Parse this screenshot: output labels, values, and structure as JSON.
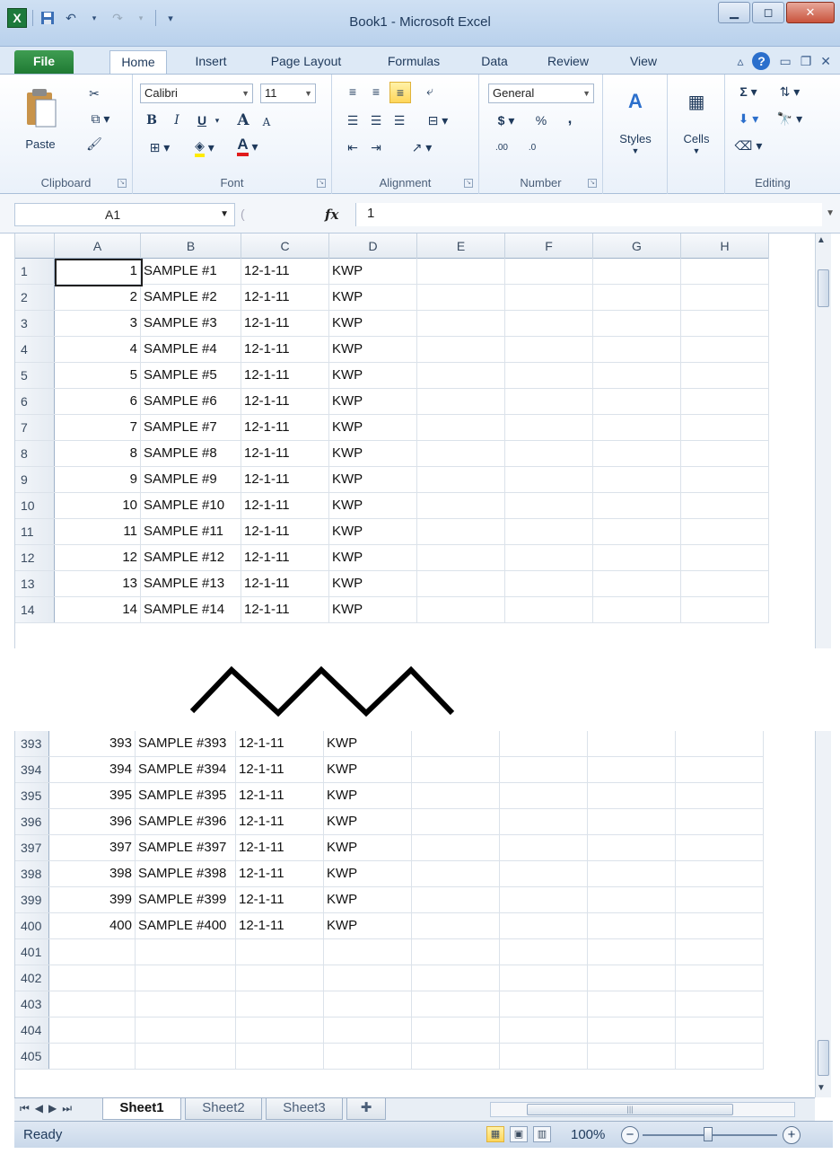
{
  "window": {
    "title": "Book1 - Microsoft Excel",
    "app_icon": "X",
    "controls": [
      "minimize-icon",
      "restore-icon",
      "close-icon"
    ]
  },
  "tabs": [
    "File",
    "Home",
    "Insert",
    "Page Layout",
    "Formulas",
    "Data",
    "Review",
    "View"
  ],
  "ribbon": {
    "clipboard": {
      "label": "Clipboard",
      "paste": "Paste"
    },
    "font": {
      "label": "Font",
      "name": "Calibri",
      "size": "11",
      "bold": "B",
      "italic": "I",
      "underline": "U",
      "grow": "A",
      "shrink": "A",
      "color": "A"
    },
    "alignment": {
      "label": "Alignment"
    },
    "number": {
      "label": "Number",
      "format": "General",
      "currency": "$",
      "percent": "%",
      "comma": ",",
      "inc_decimal": ".00",
      "dec_decimal": ".0"
    },
    "styles": {
      "label": "Styles"
    },
    "cells": {
      "label": "Cells"
    },
    "editing": {
      "label": "Editing",
      "sum": "Σ"
    }
  },
  "formula_bar": {
    "name_box": "A1",
    "fx": "fx",
    "value": "1"
  },
  "columns": [
    "A",
    "B",
    "C",
    "D",
    "E",
    "F",
    "G",
    "H"
  ],
  "rows_top": [
    {
      "n": "1",
      "a": "1",
      "b": "SAMPLE #1",
      "c": "12-1-11",
      "d": "KWP"
    },
    {
      "n": "2",
      "a": "2",
      "b": "SAMPLE #2",
      "c": "12-1-11",
      "d": "KWP"
    },
    {
      "n": "3",
      "a": "3",
      "b": "SAMPLE #3",
      "c": "12-1-11",
      "d": "KWP"
    },
    {
      "n": "4",
      "a": "4",
      "b": "SAMPLE #4",
      "c": "12-1-11",
      "d": "KWP"
    },
    {
      "n": "5",
      "a": "5",
      "b": "SAMPLE #5",
      "c": "12-1-11",
      "d": "KWP"
    },
    {
      "n": "6",
      "a": "6",
      "b": "SAMPLE #6",
      "c": "12-1-11",
      "d": "KWP"
    },
    {
      "n": "7",
      "a": "7",
      "b": "SAMPLE #7",
      "c": "12-1-11",
      "d": "KWP"
    },
    {
      "n": "8",
      "a": "8",
      "b": "SAMPLE #8",
      "c": "12-1-11",
      "d": "KWP"
    },
    {
      "n": "9",
      "a": "9",
      "b": "SAMPLE #9",
      "c": "12-1-11",
      "d": "KWP"
    },
    {
      "n": "10",
      "a": "10",
      "b": "SAMPLE #10",
      "c": "12-1-11",
      "d": "KWP"
    },
    {
      "n": "11",
      "a": "11",
      "b": "SAMPLE #11",
      "c": "12-1-11",
      "d": "KWP"
    },
    {
      "n": "12",
      "a": "12",
      "b": "SAMPLE #12",
      "c": "12-1-11",
      "d": "KWP"
    },
    {
      "n": "13",
      "a": "13",
      "b": "SAMPLE #13",
      "c": "12-1-11",
      "d": "KWP"
    },
    {
      "n": "14",
      "a": "14",
      "b": "SAMPLE #14",
      "c": "12-1-11",
      "d": "KWP"
    }
  ],
  "rows_bottom": [
    {
      "n": "393",
      "a": "393",
      "b": "SAMPLE #393",
      "c": "12-1-11",
      "d": "KWP"
    },
    {
      "n": "394",
      "a": "394",
      "b": "SAMPLE #394",
      "c": "12-1-11",
      "d": "KWP"
    },
    {
      "n": "395",
      "a": "395",
      "b": "SAMPLE #395",
      "c": "12-1-11",
      "d": "KWP"
    },
    {
      "n": "396",
      "a": "396",
      "b": "SAMPLE #396",
      "c": "12-1-11",
      "d": "KWP"
    },
    {
      "n": "397",
      "a": "397",
      "b": "SAMPLE #397",
      "c": "12-1-11",
      "d": "KWP"
    },
    {
      "n": "398",
      "a": "398",
      "b": "SAMPLE #398",
      "c": "12-1-11",
      "d": "KWP"
    },
    {
      "n": "399",
      "a": "399",
      "b": "SAMPLE #399",
      "c": "12-1-11",
      "d": "KWP"
    },
    {
      "n": "400",
      "a": "400",
      "b": "SAMPLE #400",
      "c": "12-1-11",
      "d": "KWP"
    },
    {
      "n": "401",
      "a": "",
      "b": "",
      "c": "",
      "d": ""
    },
    {
      "n": "402",
      "a": "",
      "b": "",
      "c": "",
      "d": ""
    },
    {
      "n": "403",
      "a": "",
      "b": "",
      "c": "",
      "d": ""
    },
    {
      "n": "404",
      "a": "",
      "b": "",
      "c": "",
      "d": ""
    },
    {
      "n": "405",
      "a": "",
      "b": "",
      "c": "",
      "d": ""
    }
  ],
  "sheet_tabs": [
    "Sheet1",
    "Sheet2",
    "Sheet3"
  ],
  "status": {
    "ready": "Ready",
    "zoom": "100%"
  }
}
